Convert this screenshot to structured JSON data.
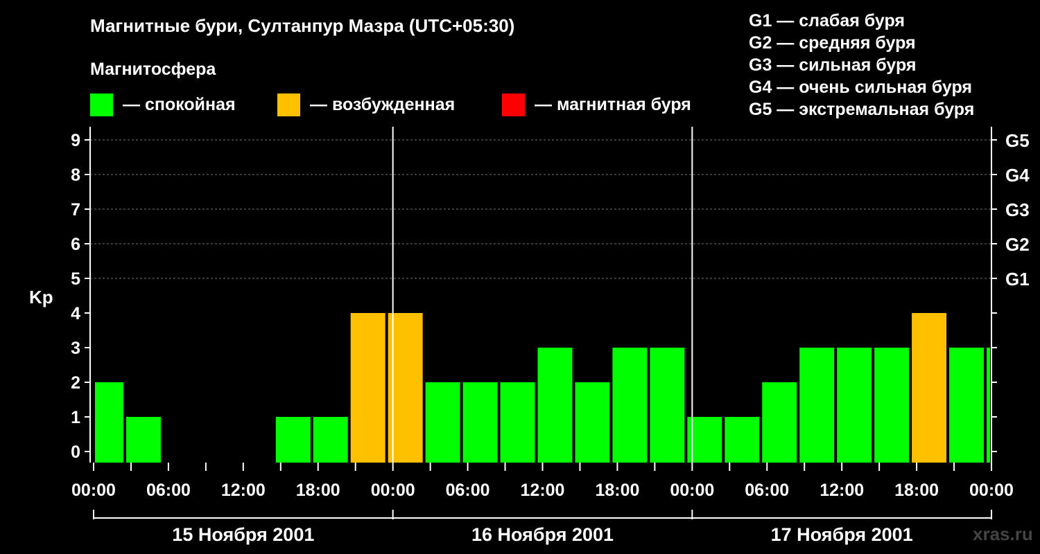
{
  "header": {
    "title": "Магнитные бури, Султанпур Мазра (UTC+05:30)",
    "magnetosphere_label": "Магнитосфера"
  },
  "legend": [
    {
      "label": "— спокойная",
      "color": "#00ff00"
    },
    {
      "label": "— возбужденная",
      "color": "#ffc000"
    },
    {
      "label": "— магнитная буря",
      "color": "#ff0000"
    }
  ],
  "g_scale": [
    "G1 — слабая буря",
    "G2 — средняя буря",
    "G3 — сильная буря",
    "G4 — очень сильная буря",
    "G5 — экстремальная буря"
  ],
  "brand": "xras.ru",
  "chart_data": {
    "type": "bar",
    "ylabel": "Kp",
    "ylim": [
      0,
      9
    ],
    "y_ticks": [
      "0",
      "1",
      "2",
      "3",
      "4",
      "5",
      "6",
      "7",
      "8",
      "9"
    ],
    "right_axis_labels": [
      {
        "kp": 5,
        "label": "G1"
      },
      {
        "kp": 6,
        "label": "G2"
      },
      {
        "kp": 7,
        "label": "G3"
      },
      {
        "kp": 8,
        "label": "G4"
      },
      {
        "kp": 9,
        "label": "G5"
      }
    ],
    "x_tick_labels": [
      "00:00",
      "06:00",
      "12:00",
      "18:00",
      "00:00",
      "06:00",
      "12:00",
      "18:00",
      "00:00",
      "06:00",
      "12:00",
      "18:00",
      "00:00"
    ],
    "days": [
      "15 Ноября 2001",
      "16 Ноября 2001",
      "17 Ноября 2001"
    ],
    "grid": "dashed horizontal at Kp 5-9",
    "bar_colors": {
      "quiet": "#00ff00",
      "active": "#ffc000",
      "storm": "#ff0000"
    },
    "bars": [
      {
        "start_hour": 0,
        "end_hour": 2.5,
        "kp": 2,
        "level": "quiet"
      },
      {
        "start_hour": 2.5,
        "end_hour": 5.5,
        "kp": 1,
        "level": "quiet"
      },
      {
        "start_hour": 5.5,
        "end_hour": 8.5,
        "kp": 0,
        "level": "quiet"
      },
      {
        "start_hour": 8.5,
        "end_hour": 11.5,
        "kp": 0,
        "level": "quiet"
      },
      {
        "start_hour": 11.5,
        "end_hour": 14.5,
        "kp": 0,
        "level": "quiet"
      },
      {
        "start_hour": 14.5,
        "end_hour": 17.5,
        "kp": 1,
        "level": "quiet"
      },
      {
        "start_hour": 17.5,
        "end_hour": 20.5,
        "kp": 1,
        "level": "quiet"
      },
      {
        "start_hour": 20.5,
        "end_hour": 23.5,
        "kp": 4,
        "level": "active"
      },
      {
        "start_hour": 23.5,
        "end_hour": 26.5,
        "kp": 4,
        "level": "active"
      },
      {
        "start_hour": 26.5,
        "end_hour": 29.5,
        "kp": 2,
        "level": "quiet"
      },
      {
        "start_hour": 29.5,
        "end_hour": 32.5,
        "kp": 2,
        "level": "quiet"
      },
      {
        "start_hour": 32.5,
        "end_hour": 35.5,
        "kp": 2,
        "level": "quiet"
      },
      {
        "start_hour": 35.5,
        "end_hour": 38.5,
        "kp": 3,
        "level": "quiet"
      },
      {
        "start_hour": 38.5,
        "end_hour": 41.5,
        "kp": 2,
        "level": "quiet"
      },
      {
        "start_hour": 41.5,
        "end_hour": 44.5,
        "kp": 3,
        "level": "quiet"
      },
      {
        "start_hour": 44.5,
        "end_hour": 47.5,
        "kp": 3,
        "level": "quiet"
      },
      {
        "start_hour": 47.5,
        "end_hour": 50.5,
        "kp": 1,
        "level": "quiet"
      },
      {
        "start_hour": 50.5,
        "end_hour": 53.5,
        "kp": 1,
        "level": "quiet"
      },
      {
        "start_hour": 53.5,
        "end_hour": 56.5,
        "kp": 2,
        "level": "quiet"
      },
      {
        "start_hour": 56.5,
        "end_hour": 59.5,
        "kp": 3,
        "level": "quiet"
      },
      {
        "start_hour": 59.5,
        "end_hour": 62.5,
        "kp": 3,
        "level": "quiet"
      },
      {
        "start_hour": 62.5,
        "end_hour": 65.5,
        "kp": 3,
        "level": "quiet"
      },
      {
        "start_hour": 65.5,
        "end_hour": 68.5,
        "kp": 4,
        "level": "active"
      },
      {
        "start_hour": 68.5,
        "end_hour": 71.5,
        "kp": 3,
        "level": "quiet"
      },
      {
        "start_hour": 71.5,
        "end_hour": 72,
        "kp": 3,
        "level": "quiet"
      }
    ]
  }
}
